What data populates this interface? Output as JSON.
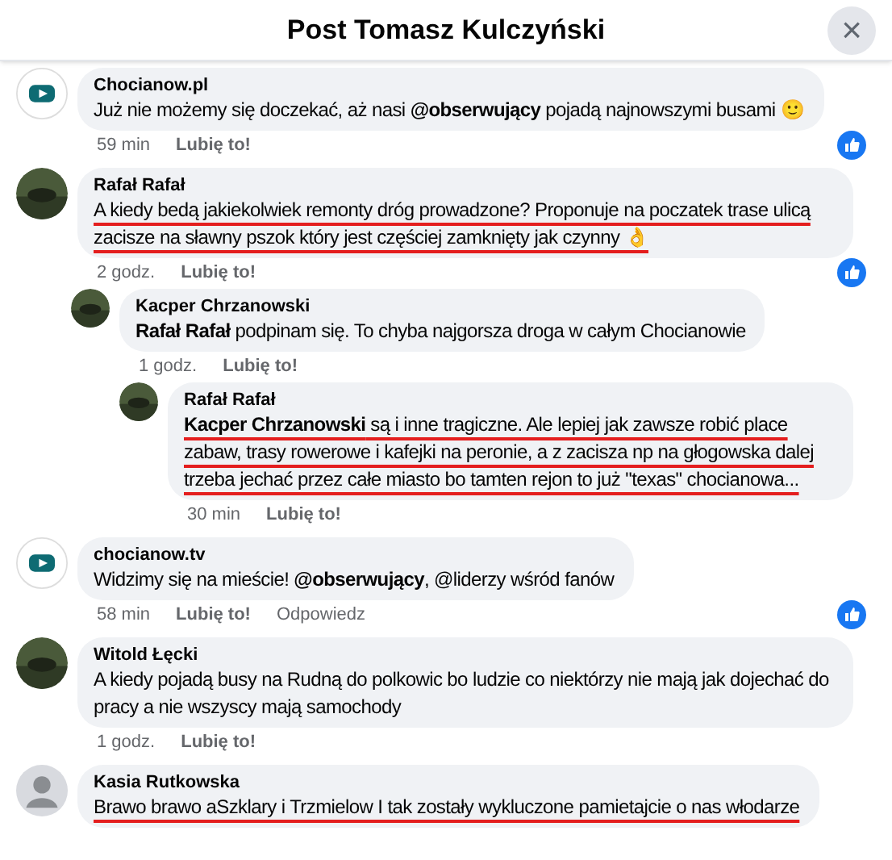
{
  "header": {
    "title": "Post Tomasz Kulczyński",
    "close": "×"
  },
  "comments": [
    {
      "author": "Chocianow.pl",
      "avatar": {
        "kind": "logo"
      },
      "body": "Już nie możemy się doczekać, aż nasi **@obserwujący** pojadą najnowszymi busami 🙂",
      "underlined": false,
      "time": "59 min",
      "like": "Lubię to!",
      "reaction": true
    },
    {
      "author": "Rafał Rafał",
      "avatar": {
        "kind": "photo"
      },
      "body": "A kiedy bedą jakiekolwiek remonty dróg prowadzone? Proponuje na poczatek trase ulicą zacisze na sławny pszok który jest częściej zamknięty jak czynny 👌",
      "underlined": true,
      "time": "2 godz.",
      "like": "Lubię to!",
      "reaction": true,
      "children": [
        {
          "author": "Kacper Chrzanowski",
          "avatar": {
            "kind": "photo"
          },
          "body": "**Rafał Rafał** podpinam się. To chyba najgorsza droga w całym Chocianowie",
          "underlined": false,
          "time": "1 godz.",
          "like": "Lubię to!",
          "reaction": false,
          "children": [
            {
              "author": "Rafał Rafał",
              "avatar": {
                "kind": "photo"
              },
              "body": "**Kacper Chrzanowski** są i inne tragiczne. Ale lepiej jak zawsze robić place zabaw, trasy rowerowe i kafejki na peronie, a z zacisza np na głogowska dalej trzeba jechać przez całe miasto bo tamten rejon to już \"texas\" chocianowa...",
              "underlined": true,
              "time": "30 min",
              "like": "Lubię to!",
              "reaction": false
            }
          ]
        }
      ]
    },
    {
      "author": "chocianow.tv",
      "avatar": {
        "kind": "logo"
      },
      "body": "Widzimy się na mieście! **@obserwujący**, @liderzy wśród fanów",
      "underlined": false,
      "time": "58 min",
      "like": "Lubię to!",
      "reply": "Odpowiedz",
      "reaction": true
    },
    {
      "author": "Witold Łęcki",
      "avatar": {
        "kind": "photo"
      },
      "body": "A kiedy pojadą busy na Rudną do polkowic bo ludzie co niektórzy nie mają jak dojechać do pracy a nie wszyscy mają samochody",
      "underlined": false,
      "time": "1 godz.",
      "like": "Lubię to!",
      "reaction": false
    },
    {
      "author": "Kasia Rutkowska",
      "avatar": {
        "kind": "default"
      },
      "body": "Brawo brawo aSzklary i Trzmielow I tak zostały wykluczone pamietajcie o nas włodarze",
      "underlined": true,
      "reaction": false
    }
  ]
}
